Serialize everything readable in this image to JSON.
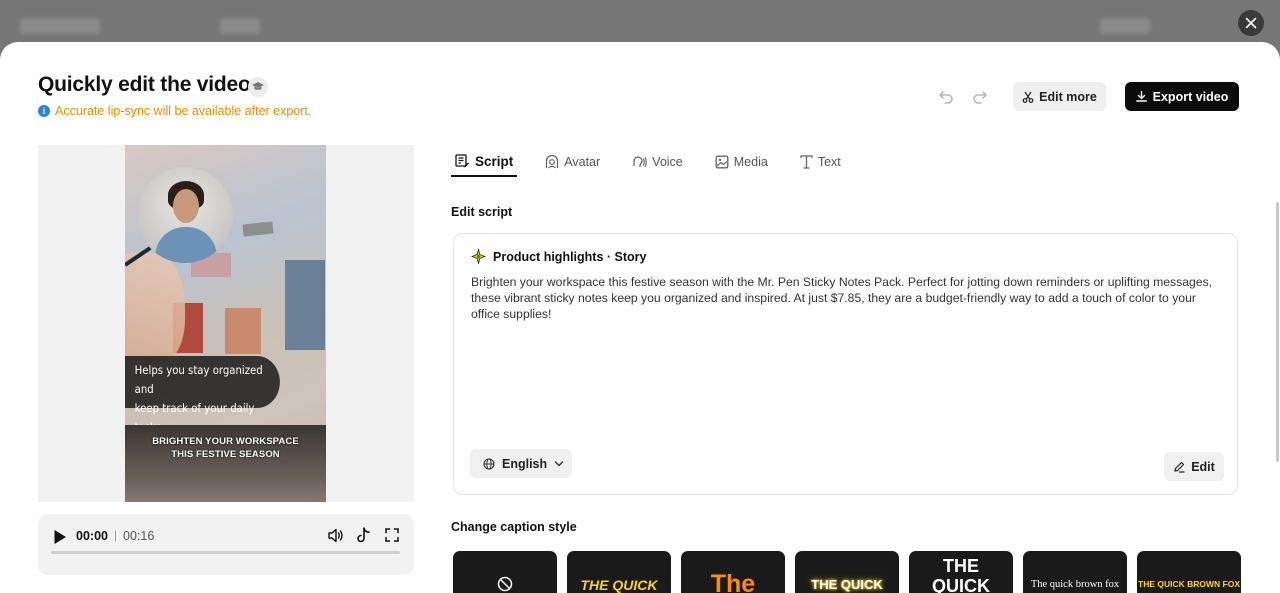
{
  "modal": {
    "title": "Quickly edit the video",
    "notice": "Accurate lip-sync will be available after export.",
    "edit_more_label": "Edit more",
    "export_label": "Export video"
  },
  "preview": {
    "caption_line1": "Helps you stay organized and",
    "caption_line2": "keep track of your daily tasks",
    "banner_line1": "BRIGHTEN YOUR WORKSPACE",
    "banner_line2": "THIS FESTIVE SEASON"
  },
  "player": {
    "current_time": "00:00",
    "separator": "|",
    "total_time": "00:16",
    "progress": 0
  },
  "tabs": [
    {
      "label": "Script",
      "icon": "script-icon",
      "active": true
    },
    {
      "label": "Avatar",
      "icon": "avatar-icon",
      "active": false
    },
    {
      "label": "Voice",
      "icon": "voice-icon",
      "active": false
    },
    {
      "label": "Media",
      "icon": "media-icon",
      "active": false
    },
    {
      "label": "Text",
      "icon": "text-icon",
      "active": false
    }
  ],
  "script": {
    "section_label": "Edit script",
    "header": "Product highlights · Story",
    "body": "Brighten your workspace this festive season with the Mr. Pen Sticky Notes Pack. Perfect for jotting down reminders or uplifting messages, these vibrant sticky notes keep you organized and inspired. At just $7.85, they are a budget-friendly way to add a touch of color to your office supplies!",
    "language": "English",
    "edit_label": "Edit"
  },
  "captions": {
    "section_label": "Change caption style",
    "styles": [
      {
        "name": "none",
        "text": ""
      },
      {
        "name": "style-1",
        "text": "THE QUICK"
      },
      {
        "name": "style-2",
        "text": "The"
      },
      {
        "name": "style-3",
        "text": "THE QUICK"
      },
      {
        "name": "style-4",
        "text": "THE\nQUICK"
      },
      {
        "name": "style-5",
        "text": "The quick brown fox"
      },
      {
        "name": "style-6",
        "text": "THE QUICK BROWN FOX"
      }
    ]
  },
  "colors": {
    "accent_dark": "#0b0b0b",
    "notice_orange": "#f08a00",
    "info_blue": "#2f80ed"
  }
}
